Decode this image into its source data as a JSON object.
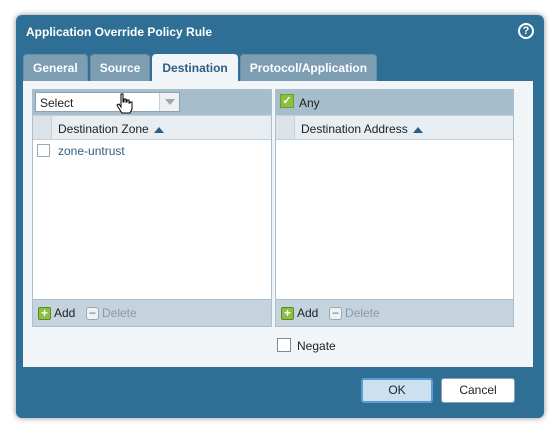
{
  "dialog": {
    "title": "Application Override Policy Rule",
    "help_glyph": "?"
  },
  "tabs": [
    {
      "label": "General",
      "active": false
    },
    {
      "label": "Source",
      "active": false
    },
    {
      "label": "Destination",
      "active": true
    },
    {
      "label": "Protocol/Application",
      "active": false
    }
  ],
  "zone_panel": {
    "select_value": "Select",
    "column_header": "Destination Zone",
    "rows": [
      {
        "label": "zone-untrust",
        "checked": false
      }
    ],
    "add_label": "Add",
    "delete_label": "Delete"
  },
  "address_panel": {
    "any_label": "Any",
    "any_checked": true,
    "column_header": "Destination Address",
    "rows": [],
    "add_label": "Add",
    "delete_label": "Delete"
  },
  "negate": {
    "label": "Negate",
    "checked": false
  },
  "footer": {
    "ok_label": "OK",
    "cancel_label": "Cancel"
  },
  "colors": {
    "dialog_bg": "#2f6f95",
    "accent": "#2d5f85",
    "add_green": "#8cbf3f"
  }
}
